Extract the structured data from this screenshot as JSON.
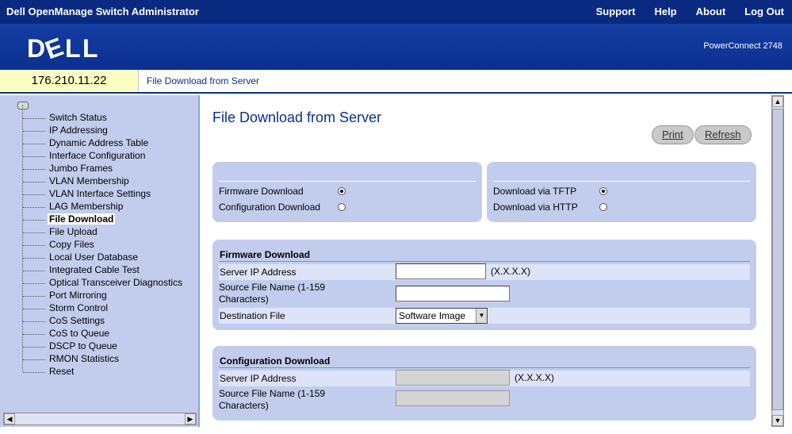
{
  "app": {
    "title": "Dell OpenManage Switch Administrator"
  },
  "top_links": [
    "Support",
    "Help",
    "About",
    "Log Out"
  ],
  "logo": {
    "text": "DELL"
  },
  "model": "PowerConnect 2748",
  "address": {
    "ip": "176.210.11.22",
    "breadcrumb": "File Download from Server"
  },
  "sidebar": {
    "items": [
      {
        "label": "Switch Status"
      },
      {
        "label": "IP Addressing"
      },
      {
        "label": "Dynamic Address Table"
      },
      {
        "label": "Interface Configuration"
      },
      {
        "label": "Jumbo Frames"
      },
      {
        "label": "VLAN Membership"
      },
      {
        "label": "VLAN Interface Settings"
      },
      {
        "label": "LAG Membership"
      },
      {
        "label": "File Download",
        "active": true
      },
      {
        "label": "File Upload"
      },
      {
        "label": "Copy Files"
      },
      {
        "label": "Local User Database"
      },
      {
        "label": "Integrated Cable Test"
      },
      {
        "label": "Optical Transceiver Diagnostics"
      },
      {
        "label": "Port Mirroring"
      },
      {
        "label": "Storm Control"
      },
      {
        "label": "CoS Settings"
      },
      {
        "label": "CoS to Queue"
      },
      {
        "label": "DSCP to Queue"
      },
      {
        "label": "RMON Statistics"
      },
      {
        "label": "Reset"
      }
    ]
  },
  "main": {
    "title": "File Download from Server",
    "print_label": "Print",
    "refresh_label": "Refresh",
    "download_type": {
      "firmware_label": "Firmware Download",
      "config_label": "Configuration Download",
      "selected": "firmware"
    },
    "download_via": {
      "tftp_label": "Download via TFTP",
      "http_label": "Download via HTTP",
      "selected": "tftp"
    },
    "firmware_section": {
      "title": "Firmware Download",
      "server_ip_label": "Server IP Address",
      "server_ip_value": "",
      "server_ip_hint": "(X.X.X.X)",
      "source_file_label_1": "Source File Name (1-159",
      "source_file_label_2": "Characters)",
      "source_file_value": "",
      "destination_label": "Destination File",
      "destination_value": "Software Image"
    },
    "config_section": {
      "title": "Configuration Download",
      "server_ip_label": "Server IP Address",
      "server_ip_hint": "(X.X.X.X)",
      "source_file_label_1": "Source File Name (1-159",
      "source_file_label_2": "Characters)"
    }
  },
  "colors": {
    "header_bg": "#0a2a82",
    "panel_bg": "#c2cdee",
    "ip_bg": "#fffcc4",
    "title_color": "#0b2f8f"
  }
}
